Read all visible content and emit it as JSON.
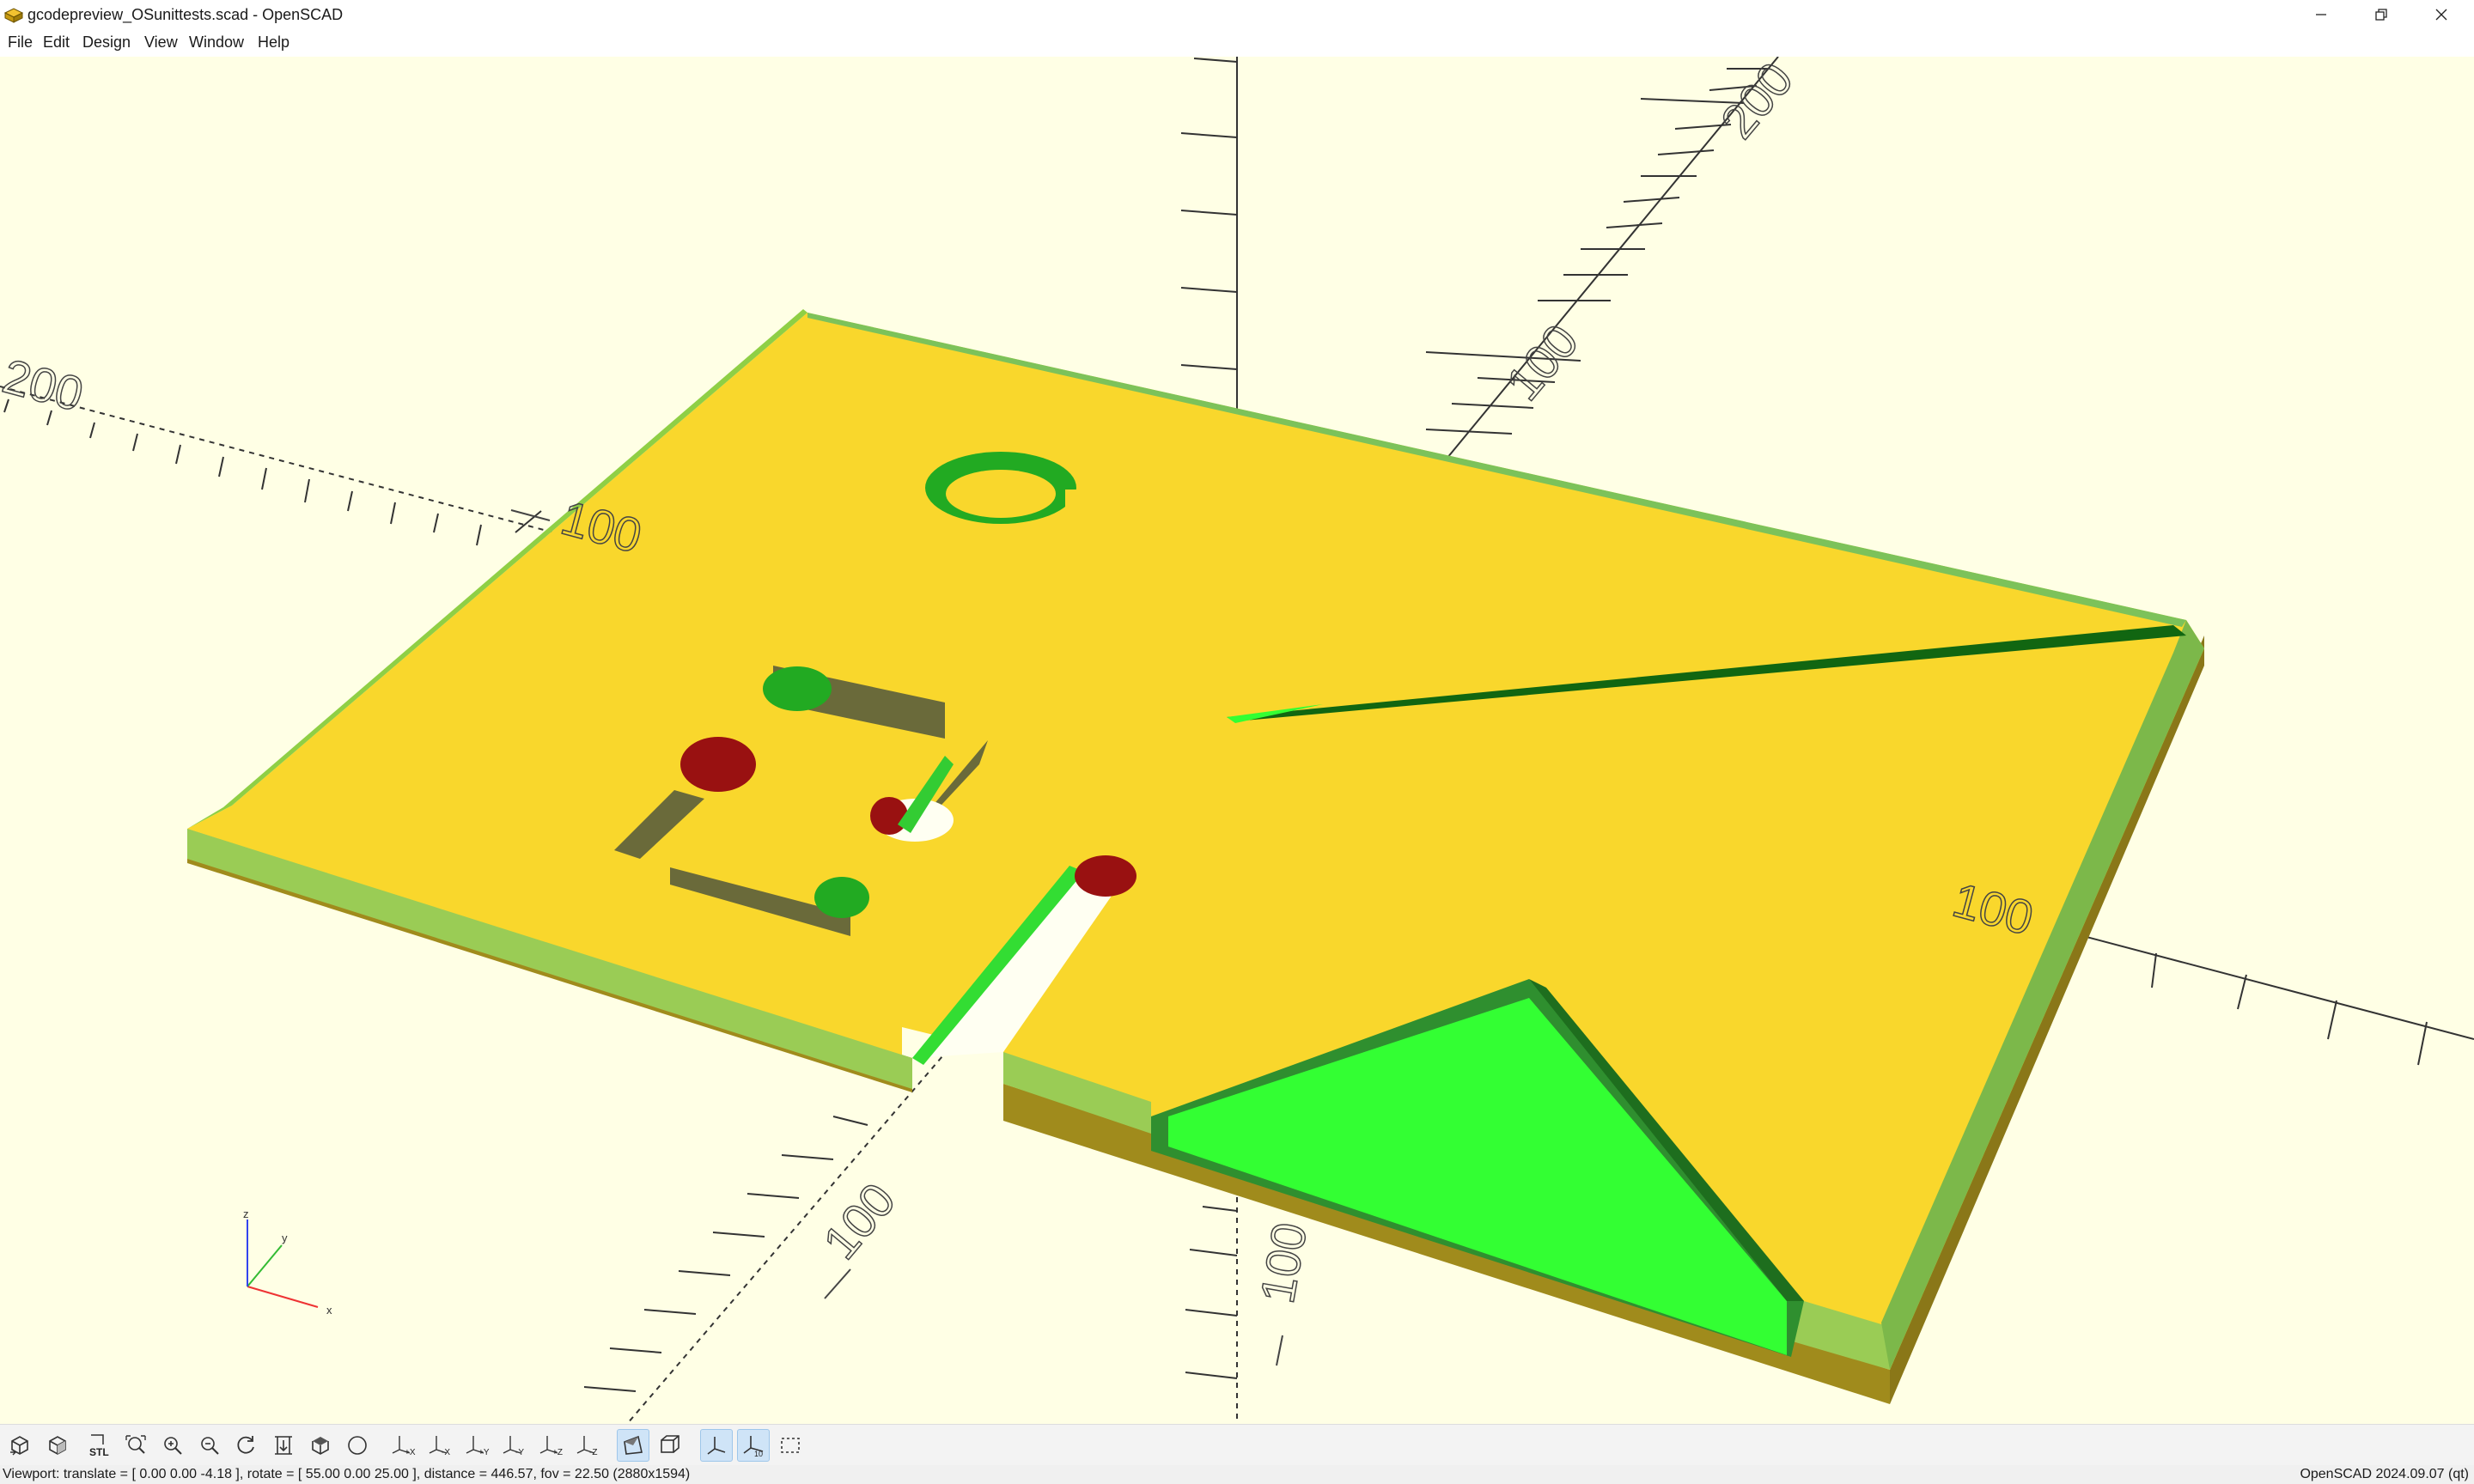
{
  "window": {
    "title": "gcodepreview_OSunittests.scad - OpenSCAD",
    "controls": [
      "minimize-icon",
      "restore-icon",
      "close-icon"
    ]
  },
  "menu": [
    {
      "label": "File"
    },
    {
      "label": "Edit"
    },
    {
      "label": "Design"
    },
    {
      "label": "View"
    },
    {
      "label": "Window"
    },
    {
      "label": "Help"
    }
  ],
  "viewport": {
    "background": "#ffffe5",
    "model_top_color": "#f9d72c",
    "model_side_color": "#a08b1c",
    "cut_color": "#33ff33",
    "axis_labels": {
      "x_pos": "100",
      "x_neg_far": "200",
      "x_neg_near": "100",
      "y_pos_near": "100",
      "y_pos_far": "200",
      "y_neg": "100",
      "z_neg": "100"
    },
    "axes_indicator": {
      "x": "x",
      "y": "y",
      "z": "z"
    }
  },
  "toolbar": {
    "buttons": [
      {
        "name": "preview-button",
        "icon": "preview-icon",
        "checked": false
      },
      {
        "name": "render-button",
        "icon": "render-icon",
        "checked": false
      },
      {
        "name": "export-stl-button",
        "icon": "stl-icon",
        "checked": false
      },
      {
        "name": "view-all-button",
        "icon": "view-all-icon",
        "checked": false
      },
      {
        "name": "zoom-in-button",
        "icon": "zoom-in-icon",
        "checked": false
      },
      {
        "name": "zoom-out-button",
        "icon": "zoom-out-icon",
        "checked": false
      },
      {
        "name": "reset-view-button",
        "icon": "reset-view-icon",
        "checked": false
      },
      {
        "name": "view-center-button",
        "icon": "center-icon",
        "checked": false
      },
      {
        "name": "view-diagonal-button",
        "icon": "diagonal-icon",
        "checked": false
      },
      {
        "name": "view-perspective-circle-button",
        "icon": "circle-icon",
        "checked": false
      },
      {
        "name": "view-right-button",
        "icon": "view-right-icon",
        "label": "+X",
        "checked": false
      },
      {
        "name": "view-left-button",
        "icon": "view-left-icon",
        "label": "-X",
        "checked": false
      },
      {
        "name": "view-back-button",
        "icon": "view-back-icon",
        "label": "+Y",
        "checked": false
      },
      {
        "name": "view-front-button",
        "icon": "view-front-icon",
        "label": "-Y",
        "checked": false
      },
      {
        "name": "view-top-button",
        "icon": "view-top-icon",
        "label": "+Z",
        "checked": false
      },
      {
        "name": "view-bottom-button",
        "icon": "view-bottom-icon",
        "label": "-Z",
        "checked": false
      },
      {
        "name": "perspective-button",
        "icon": "perspective-icon",
        "checked": true
      },
      {
        "name": "orthogonal-button",
        "icon": "orthogonal-icon",
        "checked": false
      },
      {
        "name": "show-axes-button",
        "icon": "axes-icon",
        "checked": true
      },
      {
        "name": "show-scale-button",
        "icon": "scale-markers-icon",
        "label": "10",
        "checked": true
      },
      {
        "name": "show-edges-button",
        "icon": "edges-icon",
        "checked": false
      }
    ]
  },
  "status": {
    "viewport": "Viewport: translate = [ 0.00 0.00 -4.18 ], rotate = [ 55.00 0.00 25.00 ], distance = 446.57, fov = 22.50 (2880x1594)",
    "version": "OpenSCAD 2024.09.07 (qt)"
  }
}
